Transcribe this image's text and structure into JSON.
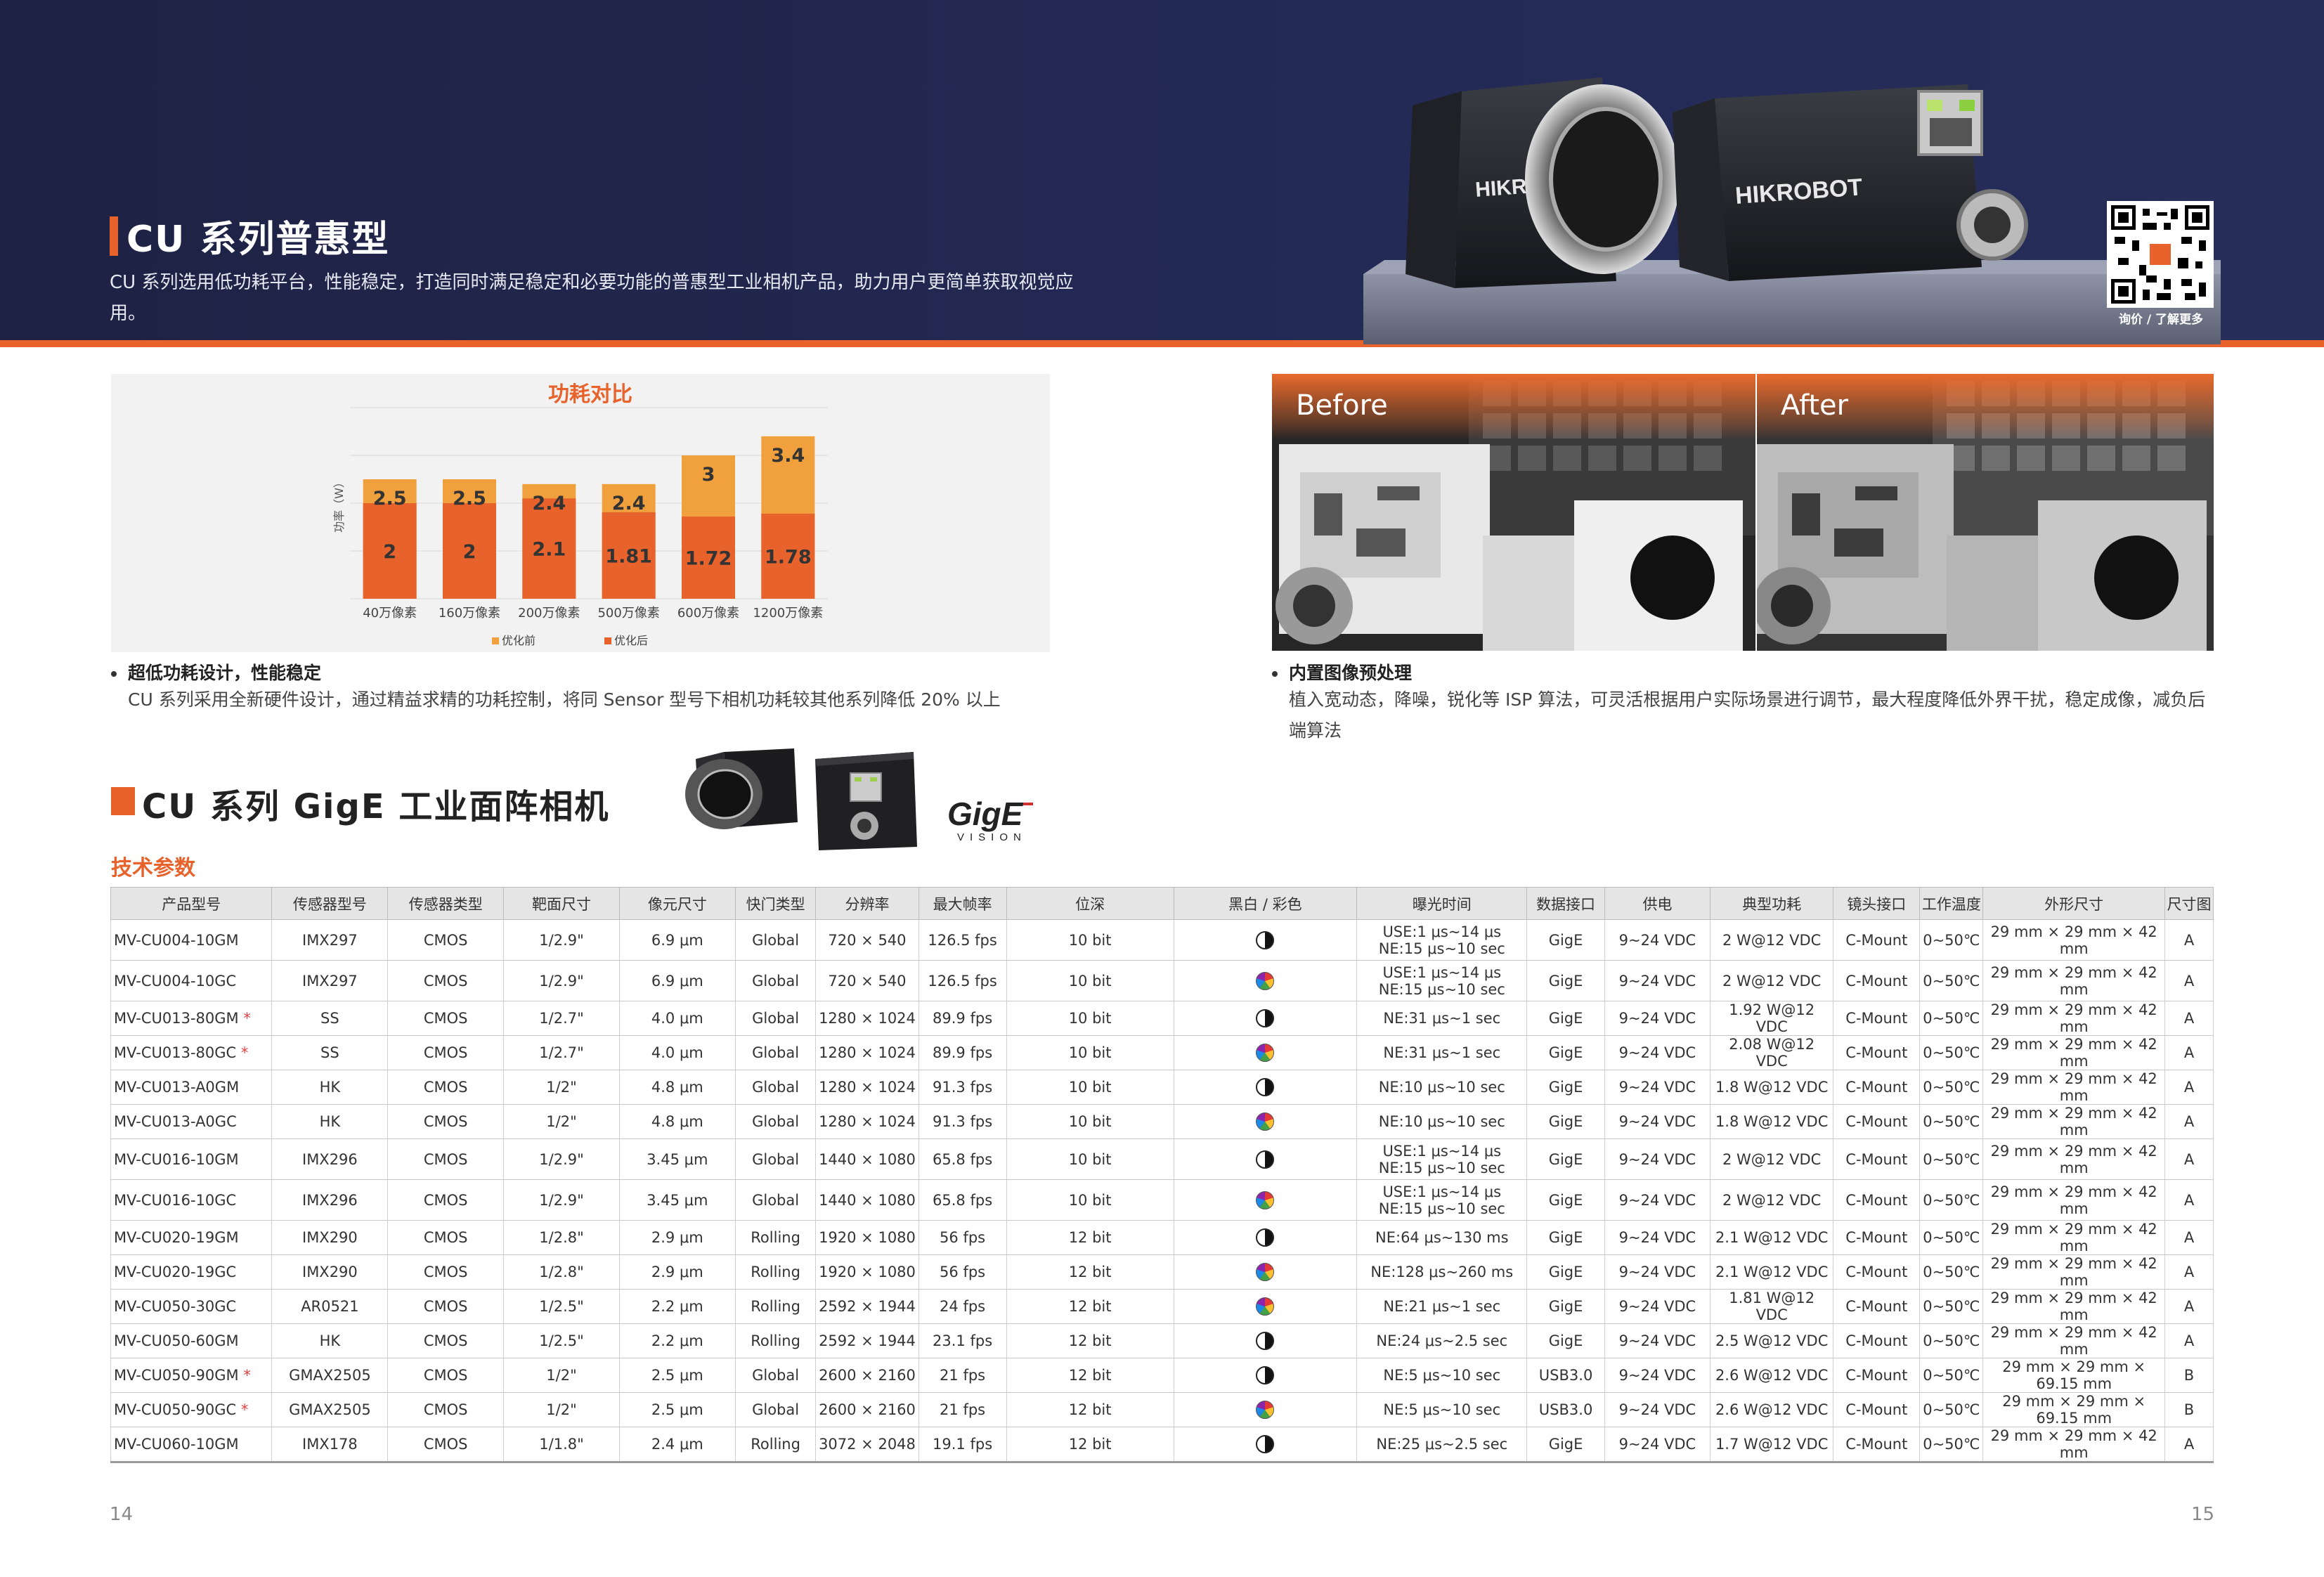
{
  "header": {
    "title": "CU 系列普惠型",
    "subtitle": "CU 系列选用低功耗平台，性能稳定，打造同时满足稳定和必要功能的普惠型工业相机产品，助力用户更简单获取视觉应用。",
    "brand": "HIKROBOT",
    "qr_caption": "询价 / 了解更多"
  },
  "chart_data": {
    "type": "bar",
    "title": "功耗对比",
    "ylabel": "功率（W）",
    "categories": [
      "40万像素",
      "160万像素",
      "200万像素",
      "500万像素",
      "600万像素",
      "1200万像素"
    ],
    "series": [
      {
        "name": "优化前",
        "values": [
          2.5,
          2.5,
          2.4,
          2.4,
          3,
          3.4
        ],
        "color": "#f0a03c"
      },
      {
        "name": "优化后",
        "values": [
          2,
          2,
          2.1,
          1.81,
          1.72,
          1.78
        ],
        "color": "#e8632c"
      }
    ],
    "grid": true,
    "legend": "bottom"
  },
  "features": {
    "power": {
      "head": "超低功耗设计，性能稳定",
      "body": "CU 系列采用全新硬件设计，通过精益求精的功耗控制，将同 Sensor 型号下相机功耗较其他系列降低 20% 以上"
    },
    "isp": {
      "head": "内置图像预处理",
      "body": "植入宽动态，降噪，锐化等 ISP 算法，可灵活根据用户实际场景进行调节，最大程度降低外界干扰，稳定成像，减负后端算法"
    }
  },
  "before_label": "Before",
  "after_label": "After",
  "section2": {
    "title": "CU 系列 GigE 工业面阵相机",
    "gige_logo": "GigE",
    "gige_sub": "VISION",
    "spec_title": "技术参数"
  },
  "table": {
    "headers": [
      "产品型号",
      "传感器型号",
      "传感器类型",
      "靶面尺寸",
      "像元尺寸",
      "快门类型",
      "分辨率",
      "最大帧率",
      "位深",
      "黑白 / 彩色",
      "曝光时间",
      "数据接口",
      "供电",
      "典型功耗",
      "镜头接口",
      "工作温度",
      "外形尺寸",
      "尺寸图"
    ],
    "rows": [
      {
        "model": "MV-CU004-10GM",
        "star": "",
        "sensor": "IMX297",
        "type": "CMOS",
        "size": "1/2.9\"",
        "pixel": "6.9 μm",
        "shutter": "Global",
        "res": "720 × 540",
        "fps": "126.5 fps",
        "bit": "10 bit",
        "mono": true,
        "exp1": "USE:1 μs~14 μs",
        "exp2": "NE:15 μs~10 sec",
        "iface": "GigE",
        "power": "9~24 VDC",
        "cons": "2 W@12 VDC",
        "lens": "C-Mount",
        "temp": "0~50℃",
        "dim": "29 mm × 29 mm × 42 mm",
        "draw": "A"
      },
      {
        "model": "MV-CU004-10GC",
        "star": "",
        "sensor": "IMX297",
        "type": "CMOS",
        "size": "1/2.9\"",
        "pixel": "6.9 μm",
        "shutter": "Global",
        "res": "720 × 540",
        "fps": "126.5 fps",
        "bit": "10 bit",
        "mono": false,
        "exp1": "USE:1 μs~14 μs",
        "exp2": "NE:15 μs~10 sec",
        "iface": "GigE",
        "power": "9~24 VDC",
        "cons": "2 W@12 VDC",
        "lens": "C-Mount",
        "temp": "0~50℃",
        "dim": "29 mm × 29 mm × 42 mm",
        "draw": "A"
      },
      {
        "model": "MV-CU013-80GM",
        "star": "*",
        "sensor": "SS",
        "type": "CMOS",
        "size": "1/2.7\"",
        "pixel": "4.0 μm",
        "shutter": "Global",
        "res": "1280 × 1024",
        "fps": "89.9 fps",
        "bit": "10 bit",
        "mono": true,
        "exp1": "NE:31 μs~1 sec",
        "exp2": "",
        "iface": "GigE",
        "power": "9~24 VDC",
        "cons": "1.92 W@12 VDC",
        "lens": "C-Mount",
        "temp": "0~50℃",
        "dim": "29 mm × 29 mm × 42 mm",
        "draw": "A"
      },
      {
        "model": "MV-CU013-80GC",
        "star": "*",
        "sensor": "SS",
        "type": "CMOS",
        "size": "1/2.7\"",
        "pixel": "4.0 μm",
        "shutter": "Global",
        "res": "1280 × 1024",
        "fps": "89.9 fps",
        "bit": "10 bit",
        "mono": false,
        "exp1": "NE:31 μs~1 sec",
        "exp2": "",
        "iface": "GigE",
        "power": "9~24 VDC",
        "cons": "2.08 W@12 VDC",
        "lens": "C-Mount",
        "temp": "0~50℃",
        "dim": "29 mm × 29 mm × 42 mm",
        "draw": "A"
      },
      {
        "model": "MV-CU013-A0GM",
        "star": "",
        "sensor": "HK",
        "type": "CMOS",
        "size": "1/2\"",
        "pixel": "4.8 μm",
        "shutter": "Global",
        "res": "1280 × 1024",
        "fps": "91.3 fps",
        "bit": "10 bit",
        "mono": true,
        "exp1": "NE:10 μs~10 sec",
        "exp2": "",
        "iface": "GigE",
        "power": "9~24 VDC",
        "cons": "1.8 W@12 VDC",
        "lens": "C-Mount",
        "temp": "0~50℃",
        "dim": "29 mm × 29 mm × 42 mm",
        "draw": "A"
      },
      {
        "model": "MV-CU013-A0GC",
        "star": "",
        "sensor": "HK",
        "type": "CMOS",
        "size": "1/2\"",
        "pixel": "4.8 μm",
        "shutter": "Global",
        "res": "1280 × 1024",
        "fps": "91.3 fps",
        "bit": "10 bit",
        "mono": false,
        "exp1": "NE:10 μs~10 sec",
        "exp2": "",
        "iface": "GigE",
        "power": "9~24 VDC",
        "cons": "1.8 W@12 VDC",
        "lens": "C-Mount",
        "temp": "0~50℃",
        "dim": "29 mm × 29 mm × 42 mm",
        "draw": "A"
      },
      {
        "model": "MV-CU016-10GM",
        "star": "",
        "sensor": "IMX296",
        "type": "CMOS",
        "size": "1/2.9\"",
        "pixel": "3.45 μm",
        "shutter": "Global",
        "res": "1440 × 1080",
        "fps": "65.8 fps",
        "bit": "10 bit",
        "mono": true,
        "exp1": "USE:1 μs~14 μs",
        "exp2": "NE:15 μs~10 sec",
        "iface": "GigE",
        "power": "9~24 VDC",
        "cons": "2 W@12 VDC",
        "lens": "C-Mount",
        "temp": "0~50℃",
        "dim": "29 mm × 29 mm × 42 mm",
        "draw": "A"
      },
      {
        "model": "MV-CU016-10GC",
        "star": "",
        "sensor": "IMX296",
        "type": "CMOS",
        "size": "1/2.9\"",
        "pixel": "3.45 μm",
        "shutter": "Global",
        "res": "1440 × 1080",
        "fps": "65.8 fps",
        "bit": "10 bit",
        "mono": false,
        "exp1": "USE:1 μs~14 μs",
        "exp2": "NE:15 μs~10 sec",
        "iface": "GigE",
        "power": "9~24 VDC",
        "cons": "2 W@12 VDC",
        "lens": "C-Mount",
        "temp": "0~50℃",
        "dim": "29 mm × 29 mm × 42 mm",
        "draw": "A"
      },
      {
        "model": "MV-CU020-19GM",
        "star": "",
        "sensor": "IMX290",
        "type": "CMOS",
        "size": "1/2.8\"",
        "pixel": "2.9 μm",
        "shutter": "Rolling",
        "res": "1920 × 1080",
        "fps": "56 fps",
        "bit": "12 bit",
        "mono": true,
        "exp1": "NE:64 μs~130 ms",
        "exp2": "",
        "iface": "GigE",
        "power": "9~24 VDC",
        "cons": "2.1 W@12 VDC",
        "lens": "C-Mount",
        "temp": "0~50℃",
        "dim": "29 mm × 29 mm × 42 mm",
        "draw": "A"
      },
      {
        "model": "MV-CU020-19GC",
        "star": "",
        "sensor": "IMX290",
        "type": "CMOS",
        "size": "1/2.8\"",
        "pixel": "2.9 μm",
        "shutter": "Rolling",
        "res": "1920 × 1080",
        "fps": "56 fps",
        "bit": "12 bit",
        "mono": false,
        "exp1": "NE:128 μs~260 ms",
        "exp2": "",
        "iface": "GigE",
        "power": "9~24 VDC",
        "cons": "2.1 W@12 VDC",
        "lens": "C-Mount",
        "temp": "0~50℃",
        "dim": "29 mm × 29 mm × 42 mm",
        "draw": "A"
      },
      {
        "model": "MV-CU050-30GC",
        "star": "",
        "sensor": "AR0521",
        "type": "CMOS",
        "size": "1/2.5\"",
        "pixel": "2.2 μm",
        "shutter": "Rolling",
        "res": "2592 × 1944",
        "fps": "24 fps",
        "bit": "12 bit",
        "mono": false,
        "exp1": "NE:21 μs~1 sec",
        "exp2": "",
        "iface": "GigE",
        "power": "9~24 VDC",
        "cons": "1.81 W@12 VDC",
        "lens": "C-Mount",
        "temp": "0~50℃",
        "dim": "29 mm × 29 mm × 42 mm",
        "draw": "A"
      },
      {
        "model": "MV-CU050-60GM",
        "star": "",
        "sensor": "HK",
        "type": "CMOS",
        "size": "1/2.5\"",
        "pixel": "2.2 μm",
        "shutter": "Rolling",
        "res": "2592 × 1944",
        "fps": "23.1 fps",
        "bit": "12 bit",
        "mono": true,
        "exp1": "NE:24 μs~2.5 sec",
        "exp2": "",
        "iface": "GigE",
        "power": "9~24 VDC",
        "cons": "2.5 W@12 VDC",
        "lens": "C-Mount",
        "temp": "0~50℃",
        "dim": "29 mm × 29 mm × 42 mm",
        "draw": "A"
      },
      {
        "model": "MV-CU050-90GM",
        "star": "*",
        "sensor": "GMAX2505",
        "type": "CMOS",
        "size": "1/2\"",
        "pixel": "2.5 μm",
        "shutter": "Global",
        "res": "2600 × 2160",
        "fps": "21 fps",
        "bit": "12 bit",
        "mono": true,
        "exp1": "NE:5 μs~10 sec",
        "exp2": "",
        "iface": "USB3.0",
        "power": "9~24 VDC",
        "cons": "2.6 W@12 VDC",
        "lens": "C-Mount",
        "temp": "0~50℃",
        "dim": "29 mm × 29 mm × 69.15 mm",
        "draw": "B"
      },
      {
        "model": "MV-CU050-90GC",
        "star": "*",
        "sensor": "GMAX2505",
        "type": "CMOS",
        "size": "1/2\"",
        "pixel": "2.5 μm",
        "shutter": "Global",
        "res": "2600 × 2160",
        "fps": "21 fps",
        "bit": "12 bit",
        "mono": false,
        "exp1": "NE:5 μs~10 sec",
        "exp2": "",
        "iface": "USB3.0",
        "power": "9~24 VDC",
        "cons": "2.6 W@12 VDC",
        "lens": "C-Mount",
        "temp": "0~50℃",
        "dim": "29 mm × 29 mm × 69.15 mm",
        "draw": "B"
      },
      {
        "model": "MV-CU060-10GM",
        "star": "",
        "sensor": "IMX178",
        "type": "CMOS",
        "size": "1/1.8\"",
        "pixel": "2.4 μm",
        "shutter": "Rolling",
        "res": "3072 × 2048",
        "fps": "19.1 fps",
        "bit": "12 bit",
        "mono": true,
        "exp1": "NE:25 μs~2.5 sec",
        "exp2": "",
        "iface": "GigE",
        "power": "9~24 VDC",
        "cons": "1.7 W@12 VDC",
        "lens": "C-Mount",
        "temp": "0~50℃",
        "dim": "29 mm × 29 mm × 42 mm",
        "draw": "A"
      }
    ]
  },
  "page_numbers": {
    "left": "14",
    "right": "15"
  }
}
